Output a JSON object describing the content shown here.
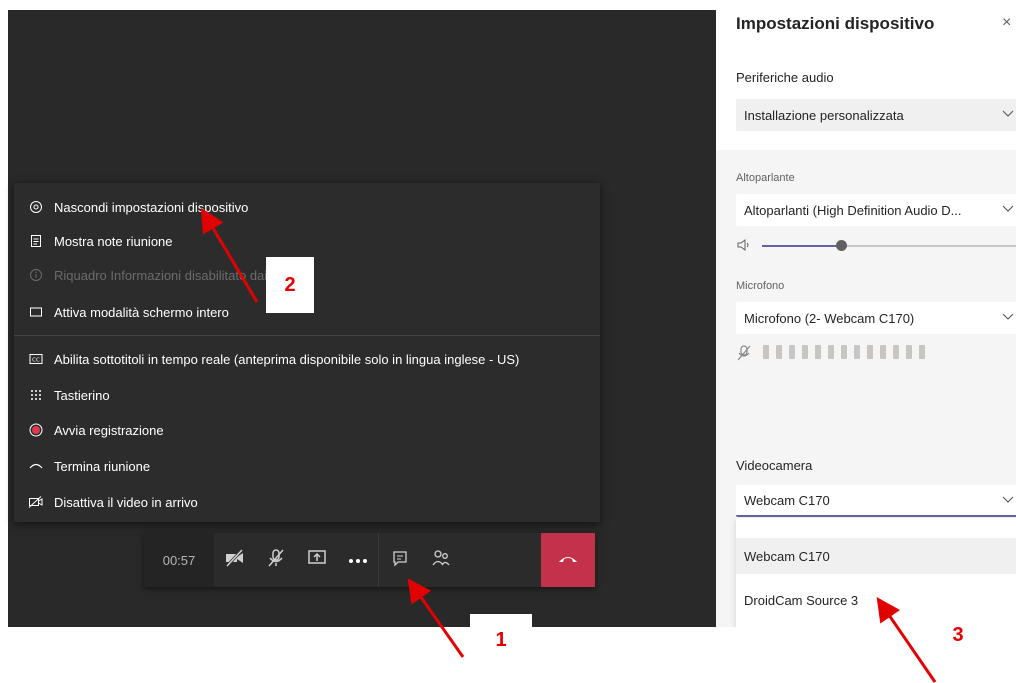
{
  "menu": {
    "items": [
      {
        "label": "Nascondi impostazioni dispositivo",
        "icon": "gear-icon",
        "disabled": false
      },
      {
        "label": "Mostra note riunione",
        "icon": "notes-icon",
        "disabled": false
      },
      {
        "label": "Riquadro Informazioni disabilitato dai criteri",
        "icon": "info-icon",
        "disabled": true
      },
      {
        "label": "Attiva modalità schermo intero",
        "icon": "fullscreen-icon",
        "disabled": false
      },
      {
        "label": "Abilita sottotitoli in tempo reale (anteprima disponibile solo in lingua inglese - US)",
        "icon": "captions-icon",
        "disabled": false
      },
      {
        "label": "Tastierino",
        "icon": "keypad-icon",
        "disabled": false
      },
      {
        "label": "Avvia registrazione",
        "icon": "record-icon",
        "disabled": false
      },
      {
        "label": "Termina riunione",
        "icon": "end-meeting-icon",
        "disabled": false
      },
      {
        "label": "Disattiva il video in arrivo",
        "icon": "video-off-icon",
        "disabled": false
      }
    ]
  },
  "toolbar": {
    "timer": "00:57",
    "buttons": [
      "camera-off-icon",
      "mic-off-icon",
      "share-screen-icon",
      "more-actions-icon",
      "chat-icon",
      "participants-icon",
      "hang-up-icon"
    ]
  },
  "panel": {
    "title": "Impostazioni dispositivo",
    "close": "×",
    "audio_section": "Periferiche audio",
    "audio_value": "Installazione personalizzata",
    "speaker_label": "Altoparlante",
    "speaker_value": "Altoparlanti (High Definition Audio D...",
    "volume_fraction": 0.31,
    "mic_label": "Microfono",
    "mic_value": "Microfono (2- Webcam C170)",
    "mic_level_count": 13,
    "camera_section": "Videocamera",
    "camera_value": "Webcam C170",
    "camera_options": [
      "Webcam C170",
      "DroidCam Source 3"
    ]
  },
  "annotations": {
    "badge_1": "1",
    "badge_2": "2",
    "badge_3": "3",
    "color": "#e00000"
  }
}
